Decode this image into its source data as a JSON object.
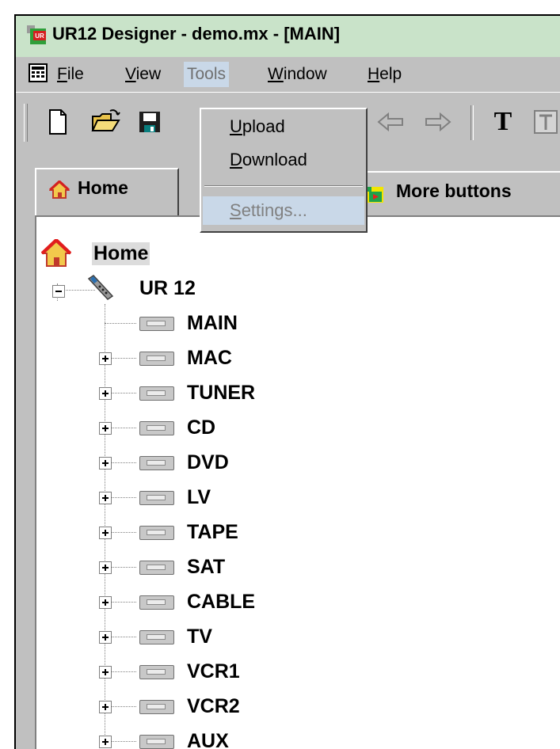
{
  "window": {
    "title": "UR12 Designer - demo.mx - [MAIN]",
    "title_icon": "app-icon"
  },
  "menubar": {
    "items": [
      {
        "label": "File",
        "underline": "F",
        "rest": "ile"
      },
      {
        "label": "View",
        "underline": "V",
        "rest": "iew"
      },
      {
        "label": "Tools",
        "underline": "",
        "rest": "Tools"
      },
      {
        "label": "Window",
        "underline": "W",
        "rest": "indow"
      },
      {
        "label": "Help",
        "underline": "H",
        "rest": "elp"
      }
    ],
    "open_menu": "Tools"
  },
  "tools_menu": {
    "items": [
      {
        "label": "Upload",
        "underline": "U",
        "rest": "pload",
        "enabled": true
      },
      {
        "label": "Download",
        "underline": "D",
        "rest": "ownload",
        "enabled": true
      },
      {
        "label": "Settings...",
        "underline": "S",
        "rest": "ettings...",
        "enabled": false
      }
    ]
  },
  "toolbar": {
    "icons": [
      "new-document-icon",
      "open-folder-icon",
      "save-icon",
      "arrow-left-icon",
      "arrow-right-icon",
      "text-tool-icon",
      "text-frame-icon"
    ],
    "text_tool_glyph": "T"
  },
  "tabs": [
    {
      "label": "Home",
      "icon": "home-icon",
      "active": true
    },
    {
      "label": "More buttons",
      "icon": "more-buttons-icon",
      "active": false
    }
  ],
  "tree": {
    "root": {
      "label": "Home",
      "icon": "home-icon"
    },
    "remote": {
      "label": "UR 12",
      "icon": "remote-control-icon",
      "expanded": true
    },
    "devices": [
      {
        "label": "MAIN",
        "expandable": false
      },
      {
        "label": "MAC",
        "expandable": true
      },
      {
        "label": "TUNER",
        "expandable": true
      },
      {
        "label": "CD",
        "expandable": true
      },
      {
        "label": "DVD",
        "expandable": true
      },
      {
        "label": "LV",
        "expandable": true
      },
      {
        "label": "TAPE",
        "expandable": true
      },
      {
        "label": "SAT",
        "expandable": true
      },
      {
        "label": "CABLE",
        "expandable": true
      },
      {
        "label": "TV",
        "expandable": true
      },
      {
        "label": "VCR1",
        "expandable": true
      },
      {
        "label": "VCR2",
        "expandable": true
      },
      {
        "label": "AUX",
        "expandable": true
      }
    ]
  }
}
